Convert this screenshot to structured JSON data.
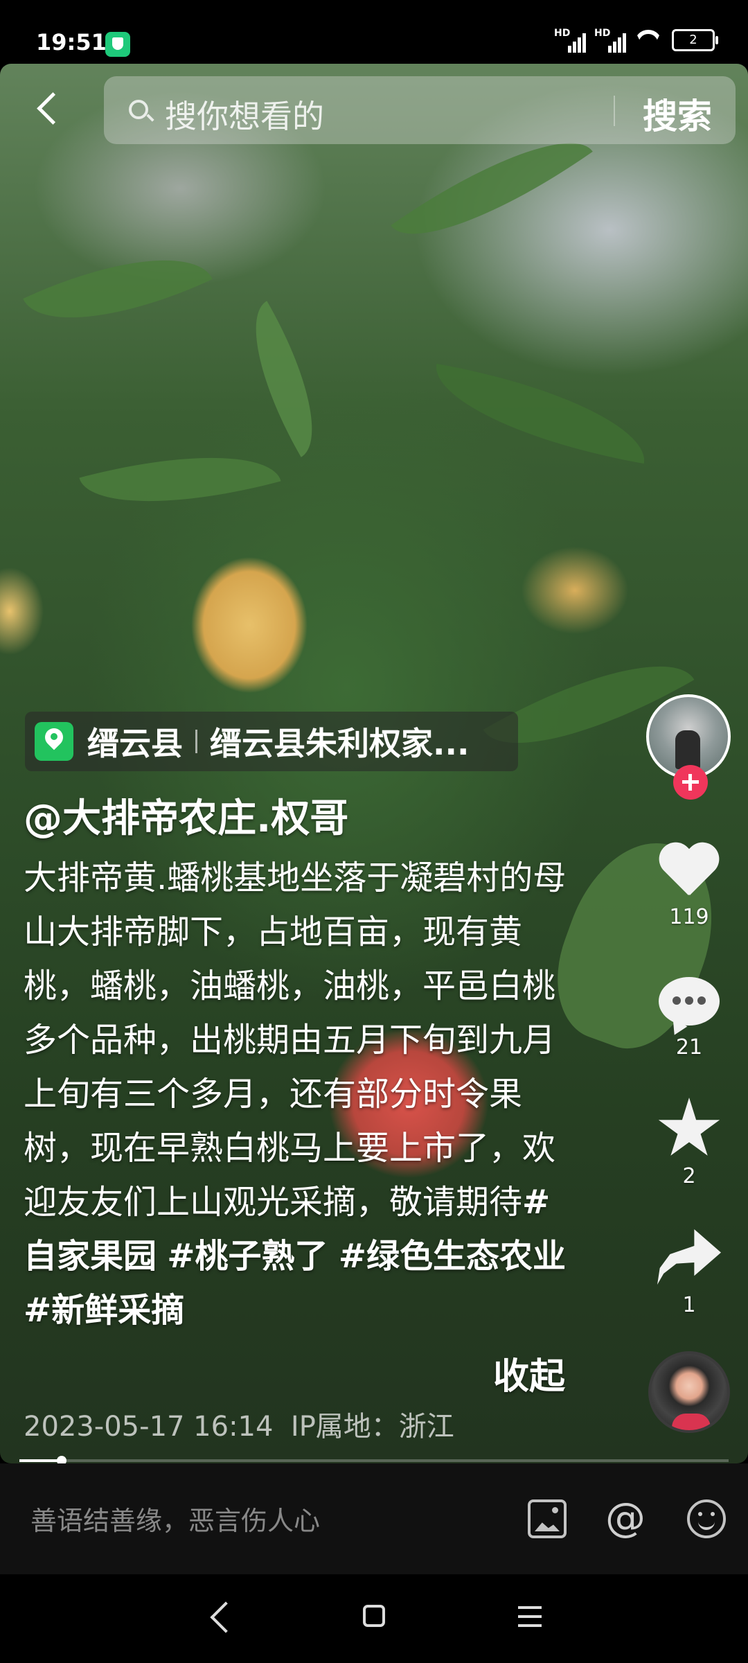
{
  "status_bar": {
    "time": "19:51",
    "sim1": "HD",
    "sim2": "HD",
    "battery": "2"
  },
  "search": {
    "placeholder": "搜你想看的",
    "button": "搜索"
  },
  "location": {
    "city": "缙云县",
    "place": "缙云县朱利权家..."
  },
  "post": {
    "author": "@大排帝农庄.权哥",
    "description_text": "大排帝黄.蟠桃基地坐落于凝碧村的母山大排帝脚下，占地百亩，现有黄桃，蟠桃，油蟠桃，油桃，平邑白桃多个品种，出桃期由五月下旬到九月上旬有三个多月，还有部分时令果树，现在早熟白桃马上要上市了，欢迎友友们上山观光采摘，敬请期待",
    "hashtags": [
      "#自家果园",
      "#桃子熟了",
      "#绿色生态农业",
      "#新鲜采摘"
    ],
    "collapse_label": "收起",
    "date": "2023-05-17 16:14",
    "ip": "IP属地：浙江"
  },
  "actions": {
    "likes": "119",
    "comments": "21",
    "favorites": "2",
    "shares": "1"
  },
  "video_progress": 0.06,
  "comment_bar": {
    "placeholder": "善语结善缘，恶言伤人心"
  },
  "icons": [
    "back-icon",
    "search-icon",
    "location-pin-icon",
    "follow-plus-icon",
    "heart-icon",
    "comment-icon",
    "star-icon",
    "share-icon",
    "music-disc-icon",
    "image-icon",
    "at-icon",
    "emoji-icon"
  ],
  "colors": {
    "follow": "#f0365b",
    "location_pin": "#22c35e"
  }
}
